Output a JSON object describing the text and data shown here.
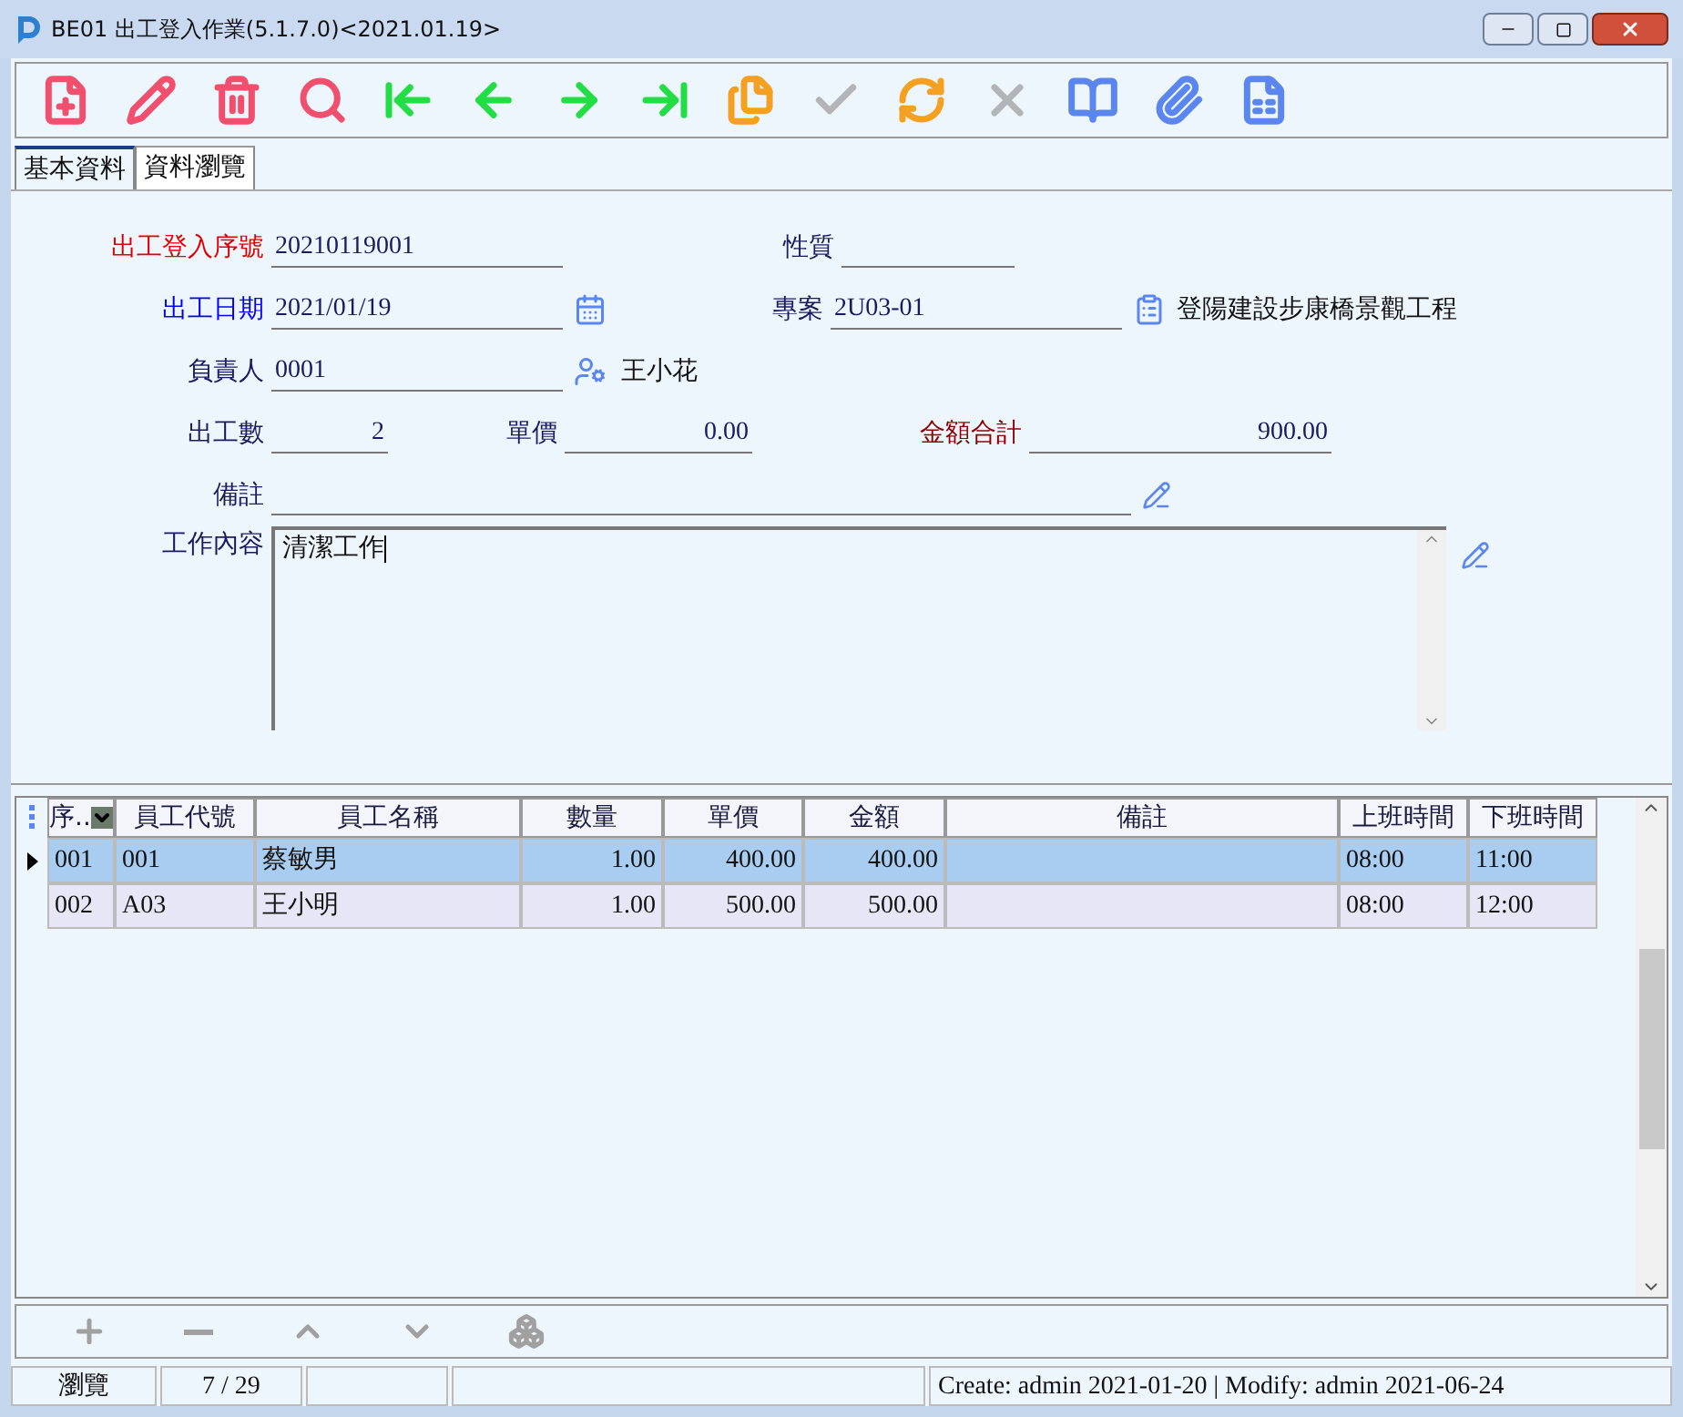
{
  "window": {
    "title": "BE01 出工登入作業(5.1.7.0)<2021.01.19>"
  },
  "toolbar": [
    {
      "kind": "new",
      "disabled": false
    },
    {
      "kind": "edit",
      "disabled": false
    },
    {
      "kind": "delete",
      "disabled": false
    },
    {
      "kind": "search",
      "disabled": false
    },
    {
      "kind": "first",
      "disabled": false
    },
    {
      "kind": "prev",
      "disabled": false
    },
    {
      "kind": "next",
      "disabled": false
    },
    {
      "kind": "last",
      "disabled": false
    },
    {
      "kind": "copy",
      "disabled": false
    },
    {
      "kind": "confirm",
      "disabled": true
    },
    {
      "kind": "refresh",
      "disabled": false
    },
    {
      "kind": "cancel",
      "disabled": true
    },
    {
      "kind": "book",
      "disabled": false
    },
    {
      "kind": "attach",
      "disabled": false
    },
    {
      "kind": "xls",
      "disabled": false
    }
  ],
  "tabs": [
    {
      "label": "基本資料",
      "selected": true
    },
    {
      "label": "資料瀏覽",
      "selected": false
    }
  ],
  "form": {
    "serial": {
      "label": "出工登入序號",
      "value": "20210119001"
    },
    "nature": {
      "label": "性質"
    },
    "date": {
      "label": "出工日期",
      "value": "2021/01/19"
    },
    "project": {
      "label": "專案",
      "value": "2U03-01",
      "name": "登陽建設步康橋景觀工程"
    },
    "owner": {
      "label": "負責人",
      "value": "0001",
      "name": "王小花"
    },
    "count": {
      "label": "出工數",
      "value": "2"
    },
    "price": {
      "label": "單價",
      "value": "0.00"
    },
    "total": {
      "label": "金額合計",
      "value": "900.00"
    },
    "note": {
      "label": "備註"
    },
    "content": {
      "label": "工作內容",
      "value": "清潔工作"
    }
  },
  "grid": {
    "columns": [
      "序..",
      "員工代號",
      "員工名稱",
      "數量",
      "單價",
      "金額",
      "備註",
      "上班時間",
      "下班時間"
    ],
    "rows": [
      {
        "selected": true,
        "cells": [
          "001",
          "001",
          "蔡敏男",
          "1.00",
          "400.00",
          "400.00",
          "",
          "08:00",
          "11:00"
        ]
      },
      {
        "selected": false,
        "cells": [
          "002",
          "A03",
          "王小明",
          "1.00",
          "500.00",
          "500.00",
          "",
          "08:00",
          "12:00"
        ]
      }
    ]
  },
  "detail_toolbar": [
    {
      "kind": "add",
      "disabled": true
    },
    {
      "kind": "remove",
      "disabled": true
    },
    {
      "kind": "up",
      "disabled": true
    },
    {
      "kind": "down",
      "disabled": true
    },
    {
      "kind": "blocks",
      "disabled": true
    }
  ],
  "status_bar": {
    "mode": "瀏覽",
    "position": "7 / 29",
    "audit": "Create: admin 2021-01-20 | Modify: admin 2021-06-24"
  }
}
